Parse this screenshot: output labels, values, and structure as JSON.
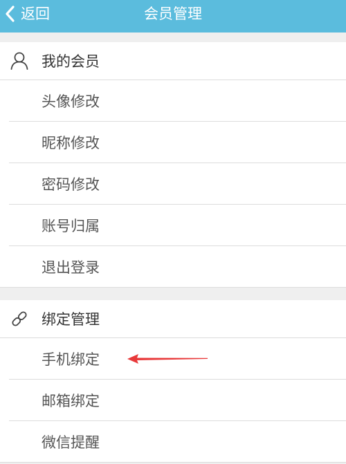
{
  "header": {
    "back_label": "返回",
    "title": "会员管理"
  },
  "sections": [
    {
      "label": "我的会员",
      "icon": "user-icon",
      "items": [
        "头像修改",
        "昵称修改",
        "密码修改",
        "账号归属",
        "退出登录"
      ]
    },
    {
      "label": "绑定管理",
      "icon": "link-icon",
      "items": [
        "手机绑定",
        "邮箱绑定",
        "微信提醒"
      ]
    }
  ],
  "colors": {
    "header_bg": "#5bbcdd",
    "page_bg": "#efefef",
    "annotation_arrow": "#e8393a"
  }
}
